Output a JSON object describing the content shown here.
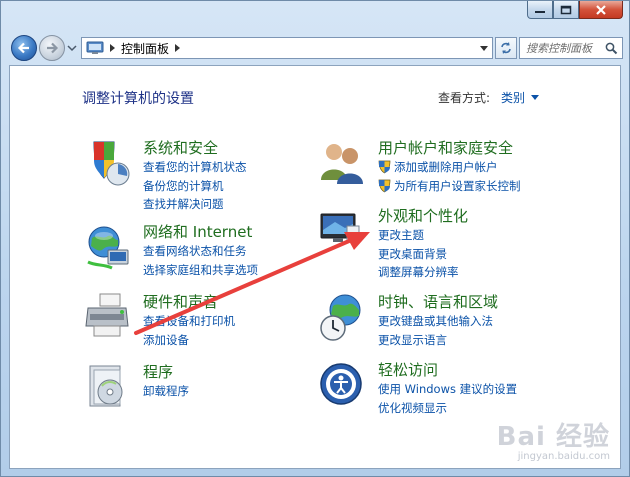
{
  "window": {
    "caption_buttons": {
      "minimize": "minimize-icon",
      "maximize": "maximize-icon",
      "close": "close-icon"
    }
  },
  "navbar": {
    "address_path": "控制面板",
    "search_placeholder": "搜索控制面板"
  },
  "content": {
    "page_title": "调整计算机的设置",
    "view_by_label": "查看方式:",
    "view_by_value": "类别"
  },
  "categories": [
    {
      "icon": "system-security-icon",
      "title": "系统和安全",
      "links": [
        "查看您的计算机状态",
        "备份您的计算机",
        "查找并解决问题"
      ]
    },
    {
      "icon": "network-internet-icon",
      "title": "网络和 Internet",
      "links": [
        "查看网络状态和任务",
        "选择家庭组和共享选项"
      ]
    },
    {
      "icon": "hardware-sound-icon",
      "title": "硬件和声音",
      "links": [
        "查看设备和打印机",
        "添加设备"
      ]
    },
    {
      "icon": "programs-icon",
      "title": "程序",
      "links": [
        "卸载程序"
      ]
    },
    {
      "icon": "user-accounts-icon",
      "title": "用户帐户和家庭安全",
      "links": [
        "添加或删除用户帐户",
        "为所有用户设置家长控制"
      ]
    },
    {
      "icon": "appearance-icon",
      "title": "外观和个性化",
      "links": [
        "更改主题",
        "更改桌面背景",
        "调整屏幕分辨率"
      ]
    },
    {
      "icon": "clock-language-icon",
      "title": "时钟、语言和区域",
      "links": [
        "更改键盘或其他输入法",
        "更改显示语言"
      ]
    },
    {
      "icon": "ease-of-access-icon",
      "title": "轻松访问",
      "links": [
        "使用 Windows 建议的设置",
        "优化视频显示"
      ]
    }
  ],
  "watermark": {
    "brand": "Bai 经验",
    "url": "jingyan.baidu.com"
  },
  "colors": {
    "category_title": "#1f6d1f",
    "link": "#0b52a8",
    "annotation_arrow": "#e8403c"
  }
}
